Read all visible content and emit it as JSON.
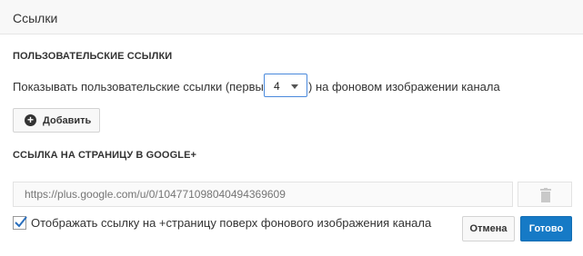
{
  "header": {
    "title": "Ссылки"
  },
  "custom_links": {
    "heading": "ПОЛЬЗОВАТЕЛЬСКИЕ ССЫЛКИ",
    "show_text_before": "Показывать пользовательские ссылки (первые",
    "count_value": "4",
    "show_text_after": ") на фоновом изображении канала",
    "add_button_label": "Добавить"
  },
  "google_plus": {
    "heading": "ССЫЛКА НА СТРАНИЦУ В GOOGLE+",
    "url_placeholder": "https://plus.google.com/u/0/104771098040494369609",
    "overlay_checked": true,
    "overlay_label": "Отображать ссылку на +страницу поверх фонового изображения канала"
  },
  "actions": {
    "cancel_label": "Отмена",
    "save_label": "Готово"
  },
  "colors": {
    "accent": "#167ac6",
    "select_border": "#4a89dc"
  },
  "icons": {
    "add": "plus-circle-icon",
    "delete": "trash-icon",
    "check": "checkmark-icon",
    "dropdown": "caret-down-icon"
  }
}
